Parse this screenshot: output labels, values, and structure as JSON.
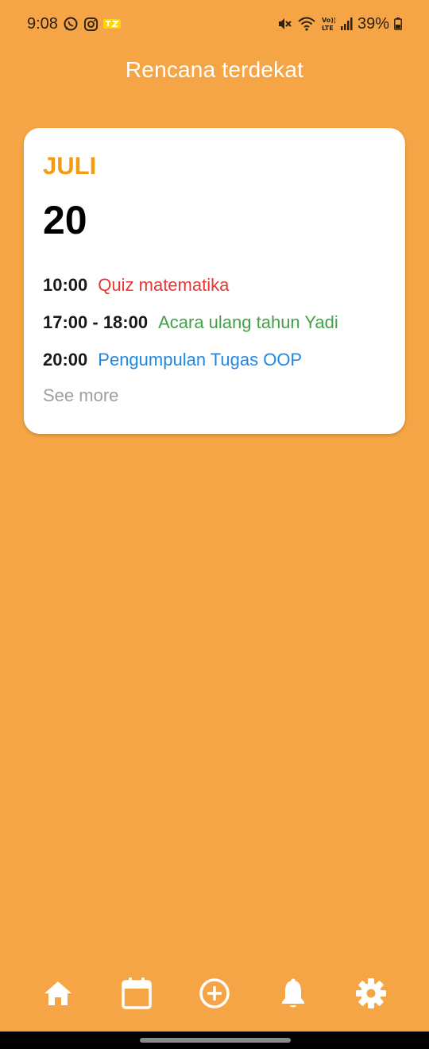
{
  "status_bar": {
    "time": "9:08",
    "battery": "39%",
    "left_icons": [
      "whatsapp-icon",
      "instagram-icon",
      "telkomsel-icon"
    ],
    "right_icons": [
      "mute-icon",
      "wifi-icon",
      "volte-icon",
      "signal-icon",
      "battery-icon"
    ]
  },
  "header": {
    "title": "Rencana terdekat"
  },
  "card": {
    "month": "JULI",
    "day": "20",
    "events": [
      {
        "time": "10:00",
        "title": "Quiz matematika",
        "color": "#E53935"
      },
      {
        "time": "17:00 - 18:00",
        "title": "Acara ulang tahun Yadi",
        "color": "#43A047"
      },
      {
        "time": "20:00",
        "title": "Pengumpulan Tugas OOP",
        "color": "#1E88E5"
      }
    ],
    "see_more": "See more"
  },
  "bottom_nav": {
    "items": [
      {
        "icon": "home-icon"
      },
      {
        "icon": "calendar-icon"
      },
      {
        "icon": "add-circle-icon"
      },
      {
        "icon": "bell-icon"
      },
      {
        "icon": "gear-icon"
      }
    ]
  },
  "colors": {
    "background": "#F5A545",
    "accent_month": "#F39C12",
    "card": "#FFFFFF",
    "muted": "#9E9E9E"
  }
}
